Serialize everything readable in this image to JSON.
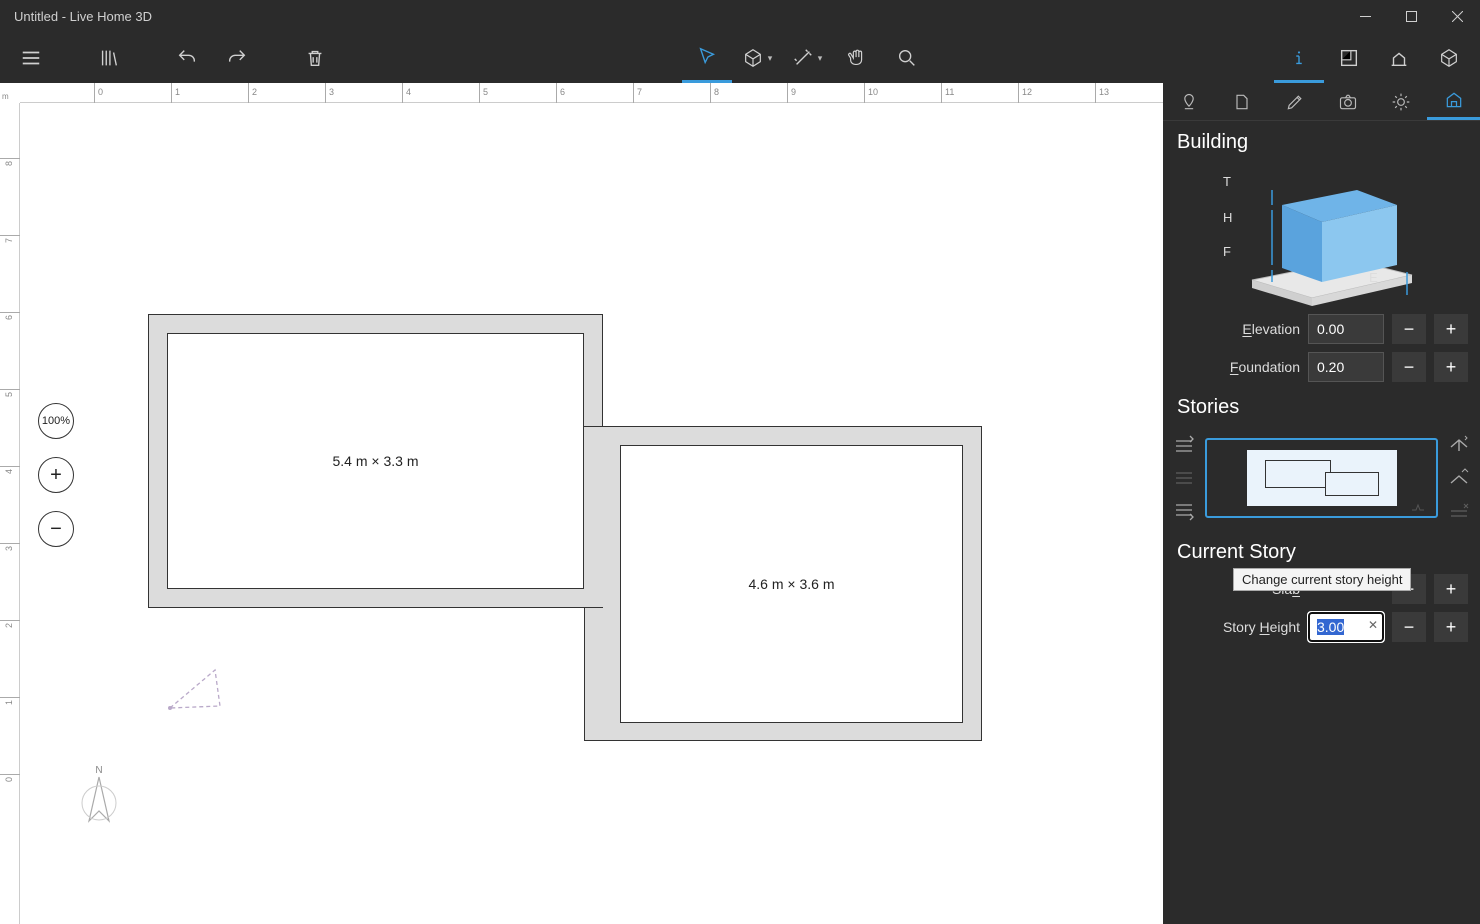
{
  "title": "Untitled - Live Home 3D",
  "ruler_unit": "m",
  "ruler_h": [
    "0",
    "1",
    "2",
    "3",
    "4",
    "5",
    "6",
    "7",
    "8",
    "9",
    "10",
    "11",
    "12",
    "13"
  ],
  "ruler_v": [
    "8",
    "7",
    "6",
    "5",
    "4",
    "3",
    "2",
    "1",
    "0"
  ],
  "zoom_label": "100%",
  "room1_dim": "5.4 m × 3.3 m",
  "room2_dim": "4.6 m × 3.6 m",
  "panel": {
    "building": "Building",
    "elevation_label": "Elevation",
    "elevation_value": "0.00",
    "foundation_label": "Foundation",
    "foundation_value": "0.20",
    "stories": "Stories",
    "current_story": "Current Story",
    "slab_label": "Slab",
    "story_height_label": "Story Height",
    "story_height_value": "3.00",
    "tooltip": "Change current story height",
    "dim_labels": {
      "T": "T",
      "H": "H",
      "F": "F",
      "E": "E"
    }
  }
}
